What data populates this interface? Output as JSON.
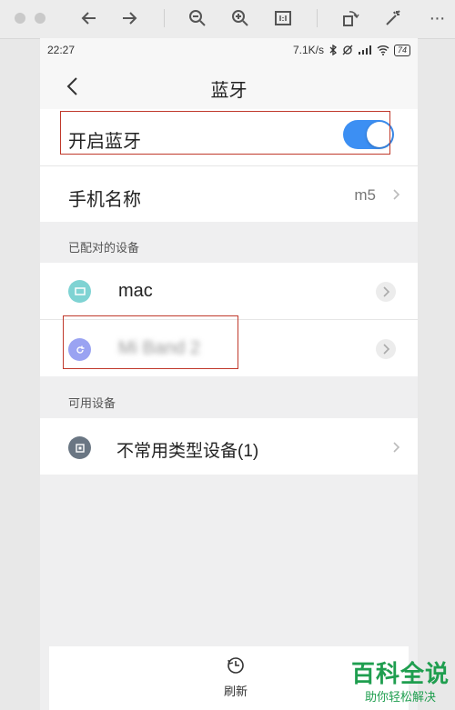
{
  "viewer_toolbar": {
    "icons": [
      "close-dot",
      "minimize-dot",
      "back-arrow",
      "forward-arrow",
      "zoom-out",
      "zoom-in",
      "actual-size",
      "rotate",
      "magic-wand",
      "more"
    ]
  },
  "status_bar": {
    "time": "22:27",
    "net_speed": "7.1K/s",
    "battery": "74"
  },
  "header": {
    "title": "蓝牙"
  },
  "bluetooth": {
    "toggle_label": "开启蓝牙",
    "enabled": true
  },
  "phone_name": {
    "label": "手机名称",
    "value": "m5"
  },
  "paired": {
    "header": "已配对的设备",
    "devices": [
      {
        "name": "mac",
        "icon": "laptop-icon",
        "icon_color": "#7fd3d3"
      },
      {
        "name": "Mi Band 2",
        "icon": "band-icon",
        "icon_color": "#9aa3f2"
      }
    ]
  },
  "available": {
    "header": "可用设备",
    "devices": [
      {
        "name": "不常用类型设备(1)",
        "icon": "device-icon",
        "icon_color": "#6a7683"
      }
    ]
  },
  "bottom": {
    "refresh_label": "刷新"
  },
  "watermark": {
    "main": "百科全说",
    "sub": "助你轻松解决"
  },
  "colors": {
    "accent": "#3c8ff3",
    "highlight": "#c0392b",
    "watermark": "#1f9e4f"
  }
}
